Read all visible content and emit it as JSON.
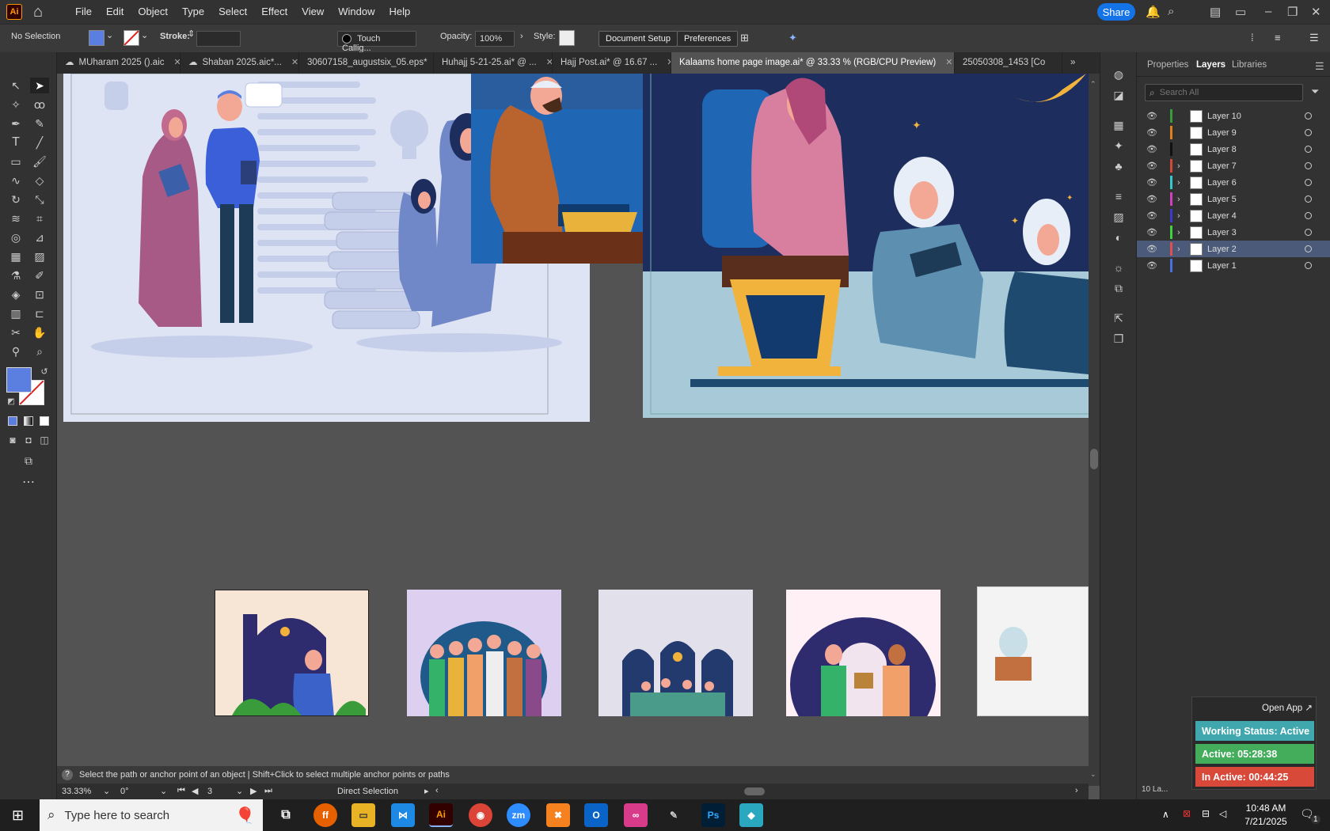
{
  "app": {
    "logo": "Ai"
  },
  "menu": [
    "File",
    "Edit",
    "Object",
    "Type",
    "Select",
    "Effect",
    "View",
    "Window",
    "Help"
  ],
  "share_label": "Share",
  "control": {
    "selection": "No Selection",
    "stroke_label": "Stroke:",
    "brush": "Touch Callig...",
    "opacity_label": "Opacity:",
    "opacity_value": "100%",
    "style_label": "Style:",
    "doc_setup": "Document Setup",
    "preferences": "Preferences",
    "fill_color": "#5b7fe0"
  },
  "tabs": [
    {
      "label": "MUharam 2025 ().aic"
    },
    {
      "label": "Shaban 2025.aic*..."
    },
    {
      "label": "30607158_augustsix_05.eps*"
    },
    {
      "label": "Huhajj 5-21-25.ai* @ ..."
    },
    {
      "label": "Hajj Post.ai* @ 16.67 ..."
    },
    {
      "label": "Kalaams home page image.ai* @ 33.33 % (RGB/CPU Preview)",
      "active": true
    },
    {
      "label": "25050308_1453 [Co"
    }
  ],
  "panel": {
    "tabs": [
      "Properties",
      "Layers",
      "Libraries"
    ],
    "search_placeholder": "Search All",
    "layers": [
      {
        "name": "Layer 10",
        "color": "#3a9b3a",
        "expand": false
      },
      {
        "name": "Layer 9",
        "color": "#e0801c",
        "expand": false
      },
      {
        "name": "Layer 8",
        "color": "#111111",
        "expand": false
      },
      {
        "name": "Layer 7",
        "color": "#d04a3a",
        "expand": true
      },
      {
        "name": "Layer 6",
        "color": "#35c8d0",
        "expand": true
      },
      {
        "name": "Layer 5",
        "color": "#d040c0",
        "expand": true
      },
      {
        "name": "Layer 4",
        "color": "#3a3ad0",
        "expand": true
      },
      {
        "name": "Layer 3",
        "color": "#40d040",
        "expand": true
      },
      {
        "name": "Layer 2",
        "color": "#e05050",
        "expand": true,
        "selected": true
      },
      {
        "name": "Layer 1",
        "color": "#4a70e0",
        "expand": false
      }
    ],
    "footer": "10 La..."
  },
  "status": {
    "hint": "Select the path or anchor point of an object  |  Shift+Click to select multiple anchor points or paths",
    "zoom": "33.33%",
    "rotation": "0°",
    "artboard": "3",
    "tool": "Direct Selection"
  },
  "widget": {
    "open_app": "Open App",
    "working": "Working Status: Active",
    "active": "Active: 05:28:38",
    "inactive": "In Active: 00:44:25"
  },
  "taskbar": {
    "search_placeholder": "Type here to search",
    "time": "10:48 AM",
    "date": "7/21/2025",
    "notif": "1"
  }
}
